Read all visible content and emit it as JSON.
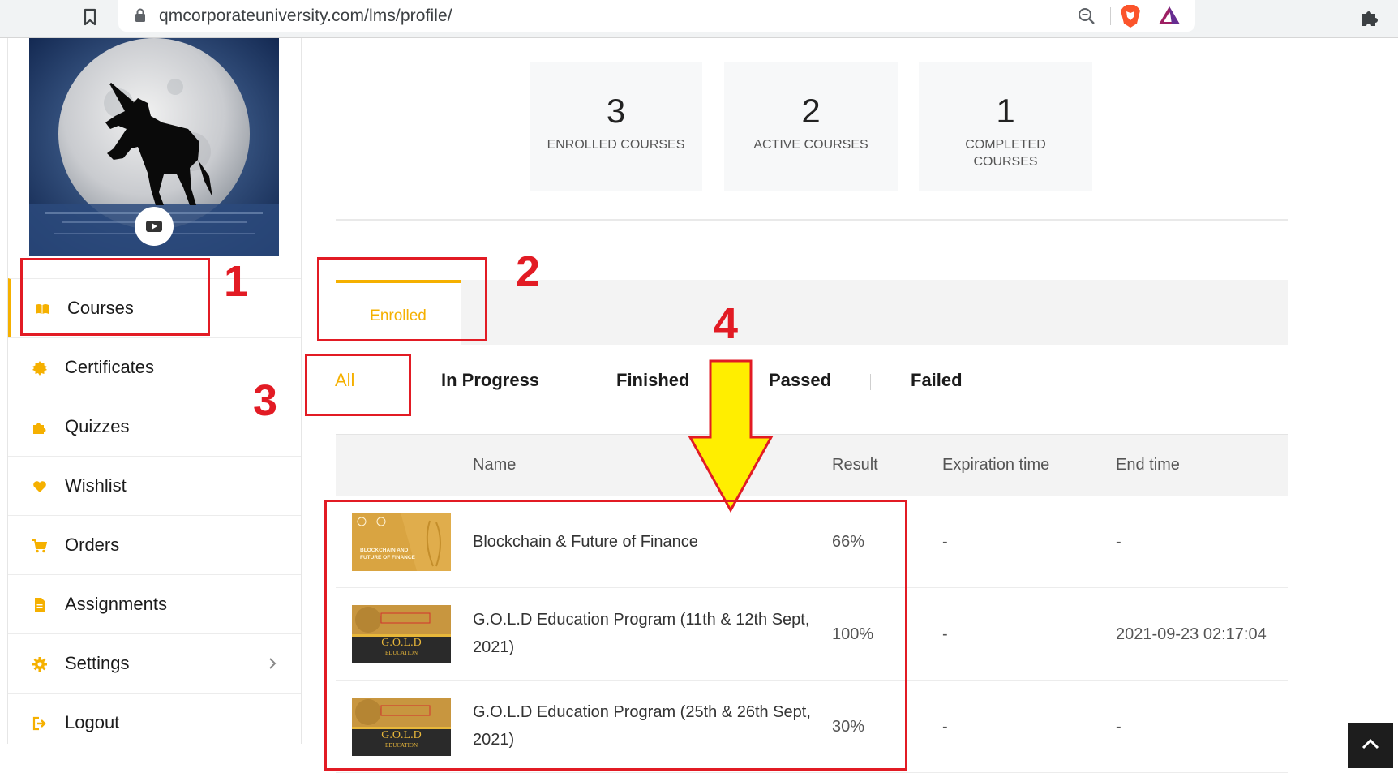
{
  "browser": {
    "url": "qmcorporateuniversity.com/lms/profile/"
  },
  "sidebar": {
    "items": [
      {
        "label": "Courses",
        "icon": "book-icon",
        "active": true
      },
      {
        "label": "Certificates",
        "icon": "badge-icon"
      },
      {
        "label": "Quizzes",
        "icon": "puzzle-icon"
      },
      {
        "label": "Wishlist",
        "icon": "heart-icon"
      },
      {
        "label": "Orders",
        "icon": "cart-icon"
      },
      {
        "label": "Assignments",
        "icon": "file-icon"
      },
      {
        "label": "Settings",
        "icon": "gear-icon",
        "has_submenu": true
      },
      {
        "label": "Logout",
        "icon": "logout-icon"
      }
    ]
  },
  "stats": [
    {
      "value": "3",
      "label": "ENROLLED COURSES"
    },
    {
      "value": "2",
      "label": "ACTIVE COURSES"
    },
    {
      "value": "1",
      "label": "COMPLETED COURSES"
    }
  ],
  "tabs": {
    "enrolled": "Enrolled"
  },
  "filters": [
    "All",
    "In Progress",
    "Finished",
    "Passed",
    "Failed"
  ],
  "table": {
    "headers": {
      "name": "Name",
      "result": "Result",
      "expiration": "Expiration time",
      "end": "End time"
    },
    "rows": [
      {
        "name": "Blockchain & Future of Finance",
        "result": "66%",
        "expiration": "-",
        "end": "-",
        "thumb_text": "BLOCKCHAIN AND FUTURE OF FINANCE"
      },
      {
        "name": "G.O.L.D Education Program (11th & 12th Sept, 2021)",
        "result": "100%",
        "expiration": "-",
        "end": "2021-09-23 02:17:04",
        "thumb_text": "G.O.L.D",
        "thumb_sub": "EDUCATION"
      },
      {
        "name": "G.O.L.D Education Program (25th & 26th Sept, 2021)",
        "result": "30%",
        "expiration": "-",
        "end": "-",
        "thumb_text": "G.O.L.D",
        "thumb_sub": "EDUCATION"
      }
    ]
  },
  "annotations": {
    "n1": "1",
    "n2": "2",
    "n3": "3",
    "n4": "4"
  },
  "colors": {
    "accent": "#f5b000",
    "annotation": "#e21b24",
    "arrow": "#ffee00"
  }
}
